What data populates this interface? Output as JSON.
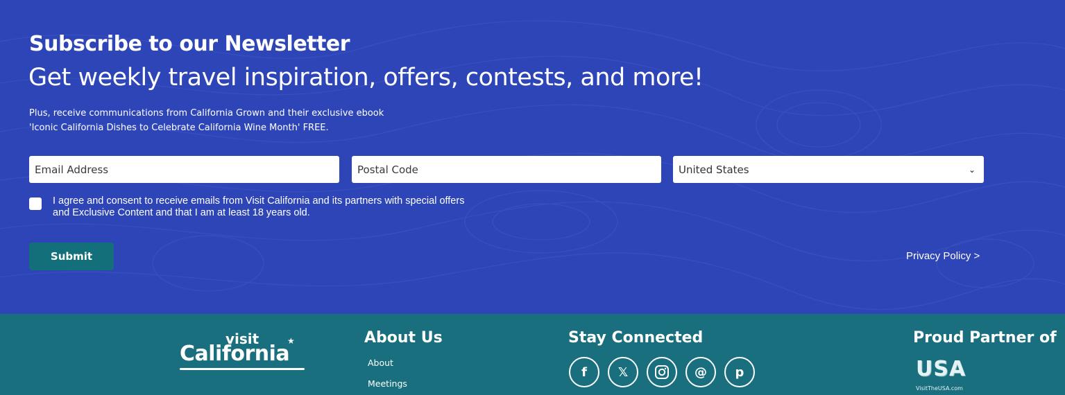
{
  "newsletter": {
    "title": "Subscribe to our Newsletter",
    "subtitle": "Get weekly travel inspiration, offers, contests, and more!",
    "description_line1": "Plus, receive communications from California Grown and their exclusive ebook",
    "description_line2": "'Iconic California Dishes to Celebrate California Wine Month' FREE.",
    "email_placeholder": "Email Address",
    "postal_placeholder": "Postal Code",
    "country_value": "United States",
    "consent_text": "I agree and consent to receive emails from Visit California and its partners with special offers and Exclusive Content and that I am at least 18 years old.",
    "submit_label": "Submit",
    "privacy_label": "Privacy Policy >"
  },
  "footer": {
    "logo_visit": "visit",
    "logo_california": "California",
    "about_heading": "About Us",
    "about_links": [
      "About",
      "Meetings"
    ],
    "stay_heading": "Stay Connected",
    "social_icons": [
      "facebook-icon",
      "x-icon",
      "instagram-icon",
      "threads-icon",
      "pinterest-icon"
    ],
    "partner_heading": "Proud Partner of",
    "partner_logo_text": "USA",
    "partner_logo_url_text": "VisitTheUSA.com"
  },
  "colors": {
    "newsletter_bg": "#2e45b8",
    "footer_bg": "#196f7d",
    "submit_bg": "#13707a"
  }
}
